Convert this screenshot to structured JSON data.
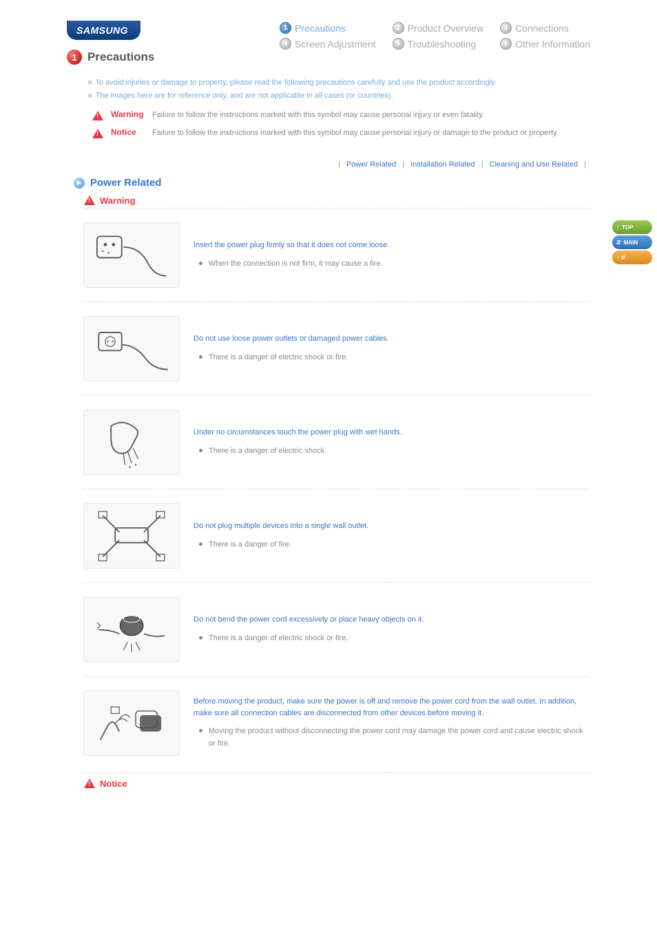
{
  "logo": "SAMSUNG",
  "title_number": "1",
  "title_text": "Precautions",
  "nav": [
    {
      "num": "1",
      "label": "Precautions",
      "active": true
    },
    {
      "num": "2",
      "label": "Product Overview",
      "active": false
    },
    {
      "num": "3",
      "label": "Connections",
      "active": false
    },
    {
      "num": "4",
      "label": "Screen Adjustment",
      "active": false
    },
    {
      "num": "5",
      "label": "Troubleshooting",
      "active": false
    },
    {
      "num": "6",
      "label": "Other Information",
      "active": false
    }
  ],
  "intro": {
    "line1": "To avoid injuries or damage to property, please read the following precautions carefully and use the product accordingly.",
    "line2": "The images here are for reference only, and are not applicable in all cases (or countries)."
  },
  "legend": {
    "warning_label": "Warning",
    "warning_text": "Failure to follow the instructions marked with this symbol may cause personal injury or even fatality.",
    "notice_label": "Notice",
    "notice_text": "Failure to follow the instructions marked with this symbol may cause personal injury or damage to the product or property."
  },
  "subnav": {
    "power": "Power Related",
    "installation": "Installation Related",
    "cleaning": "Cleaning and Use Related"
  },
  "section_title": "Power Related",
  "sub_warning": "Warning",
  "items": [
    {
      "title": "Insert the power plug firmly so that it does not come loose.",
      "desc": "When the connection is not firm, it may cause a fire."
    },
    {
      "title": "Do not use loose power outlets or damaged power cables.",
      "desc": "There is a danger of electric shock or fire."
    },
    {
      "title": "Under no circumstances touch the power plug with wet hands.",
      "desc": "There is a danger of electric shock."
    },
    {
      "title": "Do not plug multiple devices into a single wall outlet.",
      "desc": "There is a danger of fire."
    },
    {
      "title": "Do not bend the power cord excessively or place heavy objects on it.",
      "desc": "There is a danger of electric shock or fire."
    },
    {
      "title": "Before moving the product, make sure the power is off and remove the power cord from the wall outlet. In addition, make sure all connection cables are disconnected from other devices before moving it.",
      "desc": "Moving the product without disconnecting the power cord may damage the power cord and cause electric shock or fire."
    }
  ],
  "notice_bottom": "Notice",
  "side": {
    "top": "TOP",
    "main": "MAIN"
  }
}
